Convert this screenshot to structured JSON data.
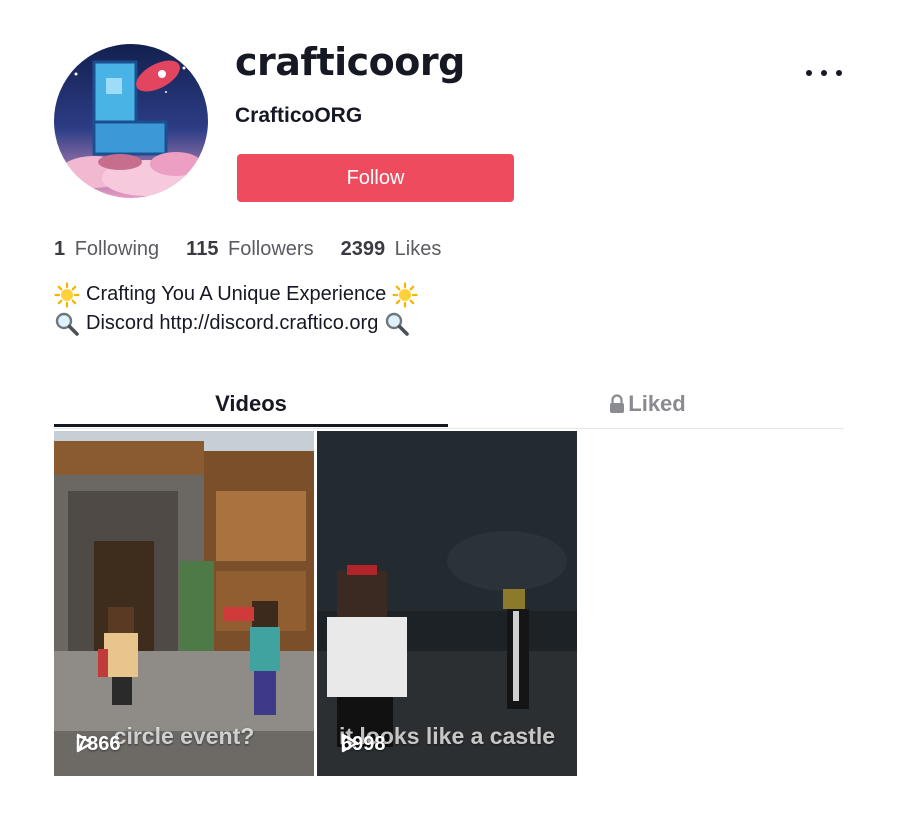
{
  "profile": {
    "username": "crafticoorg",
    "nickname": "CrafticoORG",
    "follow_label": "Follow",
    "more_icon": "more-horizontal-icon"
  },
  "stats": {
    "following_count": "1",
    "following_label": "Following",
    "followers_count": "115",
    "followers_label": "Followers",
    "likes_count": "2399",
    "likes_label": "Likes"
  },
  "bio": {
    "line1": "Crafting You A Unique Experience",
    "line2": "Discord http://discord.craftico.org"
  },
  "tabs": {
    "videos": "Videos",
    "liked": "Liked"
  },
  "videos": [
    {
      "views": "7866",
      "caption": "circle event?"
    },
    {
      "views": "6998",
      "caption": "it looks like a castle"
    }
  ],
  "colors": {
    "follow_button": "#ee4b5f",
    "text_primary": "#161823",
    "text_muted": "#8a8b91"
  }
}
